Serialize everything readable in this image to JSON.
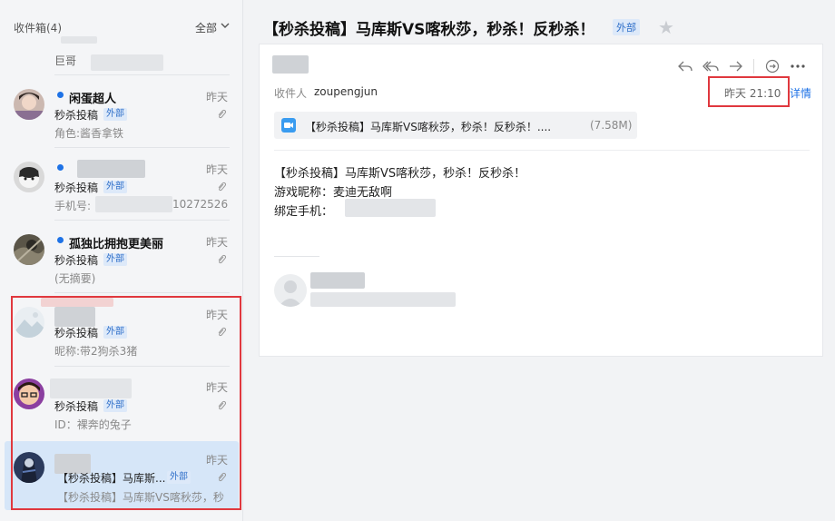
{
  "sidebar": {
    "title": "收件箱(4)",
    "filter": "全部",
    "items": [
      {
        "sender": "巨哥",
        "date": "",
        "subject": "",
        "badge": "",
        "summary": ""
      },
      {
        "sender": "闲蛋超人",
        "date": "昨天",
        "subject": "秒杀投稿",
        "badge": "外部",
        "summary": "角色:酱香拿铁"
      },
      {
        "sender": "",
        "date": "昨天",
        "subject": "秒杀投稿",
        "badge": "外部",
        "summary": "手机号:",
        "summary_tail": "10272526"
      },
      {
        "sender": "孤独比拥抱更美丽",
        "date": "昨天",
        "subject": "秒杀投稿",
        "badge": "外部",
        "summary": "(无摘要)"
      },
      {
        "sender": "",
        "date": "昨天",
        "subject": "秒杀投稿",
        "badge": "外部",
        "summary": "昵称:带2狗杀3猪"
      },
      {
        "sender": "",
        "date": "昨天",
        "subject": "秒杀投稿",
        "badge": "外部",
        "summary": "ID：裸奔的兔子"
      },
      {
        "sender": "",
        "date": "昨天",
        "subject": "【秒杀投稿】马库斯...",
        "badge": "外部",
        "summary": "【秒杀投稿】马库斯VS喀秋莎，秒"
      }
    ]
  },
  "mail": {
    "subject": "【秒杀投稿】马库斯VS喀秋莎，秒杀！反秒杀！",
    "badge": "外部",
    "recipient_label": "收件人",
    "recipient": "zoupengjun",
    "time": "昨天 21:10",
    "detail_link": "详情",
    "attachment": {
      "name": "【秒杀投稿】马库斯VS喀秋莎，秒杀！反秒杀！....",
      "size": "(7.58M)"
    },
    "body": [
      "【秒杀投稿】马库斯VS喀秋莎，秒杀！反秒杀！",
      "游戏昵称：麦迪无敌啊",
      "绑定手机："
    ]
  },
  "colors": {
    "accent": "#1e72e6",
    "highlight_box": "#e0383e",
    "selected_bg": "#d6e6f8"
  },
  "icons": [
    "reply-icon",
    "reply-all-icon",
    "forward-icon",
    "more-actions-icon",
    "menu-dots-icon",
    "attachment-clip-icon",
    "video-file-icon",
    "star-icon",
    "chevron-down-icon"
  ]
}
